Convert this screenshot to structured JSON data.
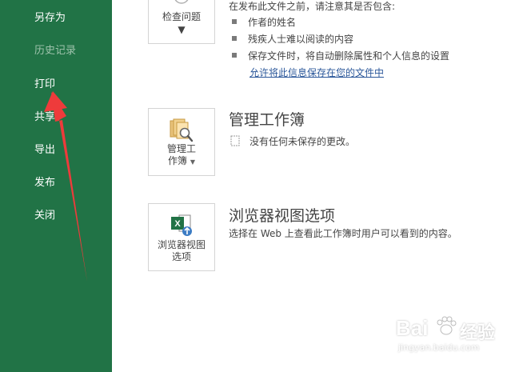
{
  "sidebar": {
    "items": [
      {
        "label": "另存为",
        "enabled": true
      },
      {
        "label": "历史记录",
        "enabled": false
      },
      {
        "label": "打印",
        "enabled": true
      },
      {
        "label": "共享",
        "enabled": true
      },
      {
        "label": "导出",
        "enabled": true
      },
      {
        "label": "发布",
        "enabled": true
      },
      {
        "label": "关闭",
        "enabled": true
      }
    ]
  },
  "inspect": {
    "button_label": "检查问题",
    "intro": "在发布此文件之前，请注意其是否包含:",
    "bullets": [
      "作者的姓名",
      "残疾人士难以阅读的内容",
      "保存文件时，将自动删除属性和个人信息的设置"
    ],
    "link": "允许将此信息保存在您的文件中"
  },
  "manage": {
    "title": "管理工作簿",
    "button_line1": "管理工",
    "button_line2": "作簿",
    "status": "没有任何未保存的更改。"
  },
  "browser": {
    "title": "浏览器视图选项",
    "button_line1": "浏览器视图",
    "button_line2": "选项",
    "description": "选择在 Web 上查看此工作簿时用户可以看到的内容。"
  },
  "watermark": {
    "brand": "Bai",
    "brand2": "经验",
    "url": "jingyan.baidu.com"
  },
  "colors": {
    "sidebar": "#217346",
    "arrow": "#ee3b3b",
    "link": "#2b579a"
  },
  "icons": {
    "inspect": "inspect-document-icon",
    "manage": "manage-workbook-icon",
    "browser": "browser-view-excel-icon",
    "status": "document-status-icon"
  }
}
